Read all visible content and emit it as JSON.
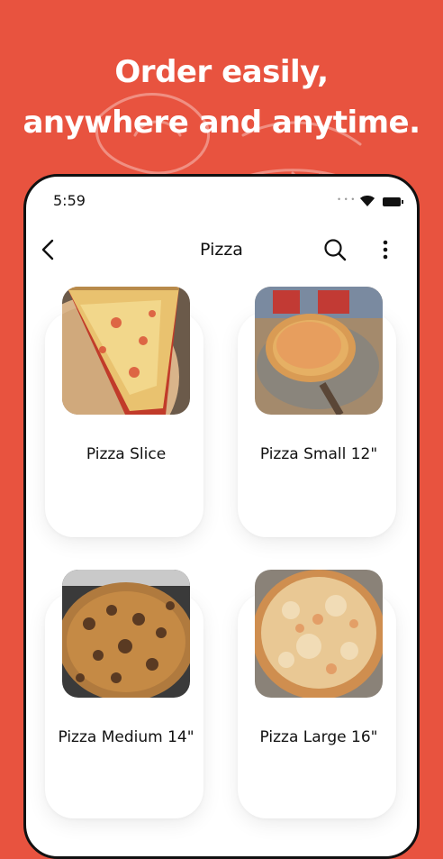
{
  "headline": {
    "line1": "Order easily,",
    "line2": "anywhere and anytime."
  },
  "status_bar": {
    "time": "5:59",
    "dots": "• • •"
  },
  "appbar": {
    "title": "Pizza"
  },
  "icons": [
    "chevron-left-icon",
    "search-icon",
    "more-vertical-icon",
    "wifi-icon",
    "battery-icon"
  ],
  "colors": {
    "accent": "#E8533F",
    "card": "#FFFFFF",
    "text": "#111111"
  },
  "products": [
    {
      "name": "Pizza Slice"
    },
    {
      "name": "Pizza Small 12\""
    },
    {
      "name": "Pizza Medium 14\""
    },
    {
      "name": "Pizza Large 16\""
    }
  ]
}
